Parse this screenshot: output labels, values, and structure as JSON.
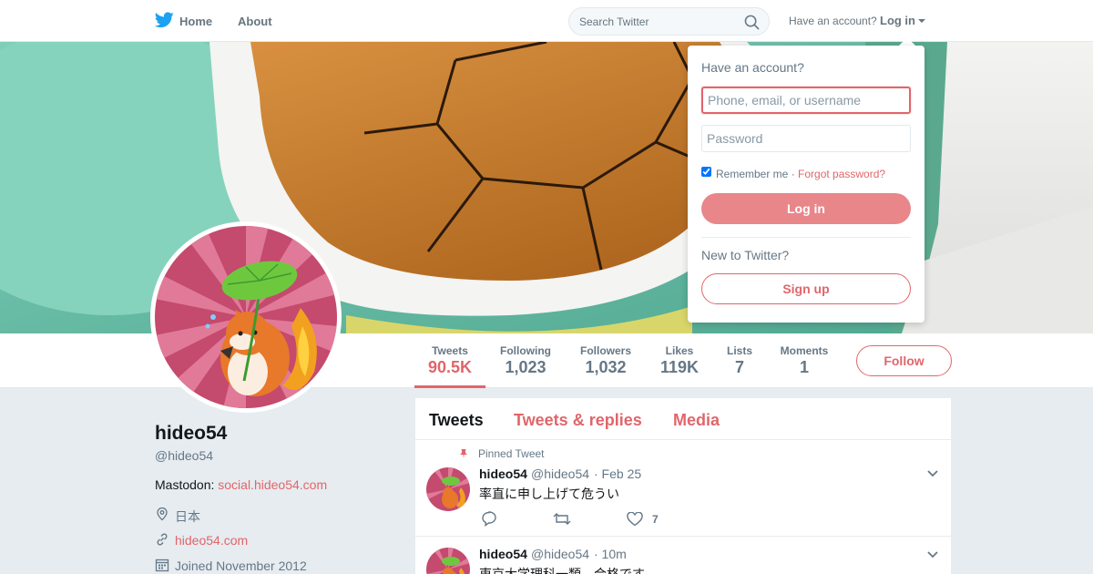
{
  "colors": {
    "accent": "#e0666b",
    "twitter_blue": "#1da1f2",
    "muted": "#657786"
  },
  "nav": {
    "logo_icon": "twitter-bird-icon",
    "home": "Home",
    "about": "About",
    "search_placeholder": "Search Twitter",
    "have_account": "Have an account?",
    "login": "Log in"
  },
  "profile": {
    "name": "hideo54",
    "handle": "@hideo54",
    "bio_prefix": "Mastodon: ",
    "bio_link": "social.hideo54.com",
    "location": "日本",
    "website": "hideo54.com",
    "joined": "Joined November 2012"
  },
  "stats": [
    {
      "label": "Tweets",
      "value": "90.5K"
    },
    {
      "label": "Following",
      "value": "1,023"
    },
    {
      "label": "Followers",
      "value": "1,032"
    },
    {
      "label": "Likes",
      "value": "119K"
    },
    {
      "label": "Lists",
      "value": "7"
    },
    {
      "label": "Moments",
      "value": "1"
    }
  ],
  "follow_button": "Follow",
  "timeline": {
    "tabs": [
      "Tweets",
      "Tweets & replies",
      "Media"
    ],
    "tweets": [
      {
        "pinned_label": "Pinned Tweet",
        "name": "hideo54",
        "handle": "@hideo54",
        "time": "· Feb 25",
        "text": "率直に申し上げて危うい",
        "likes": "7"
      },
      {
        "name": "hideo54",
        "handle": "@hideo54",
        "time": "· 10m",
        "text": "東京大学理科一類、合格です"
      }
    ]
  },
  "login_dropdown": {
    "title": "Have an account?",
    "username_placeholder": "Phone, email, or username",
    "password_placeholder": "Password",
    "remember_me": "Remember me",
    "separator": " · ",
    "forgot_password": "Forgot password?",
    "login_button": "Log in",
    "new_to_twitter": "New to Twitter?",
    "signup_button": "Sign up"
  }
}
